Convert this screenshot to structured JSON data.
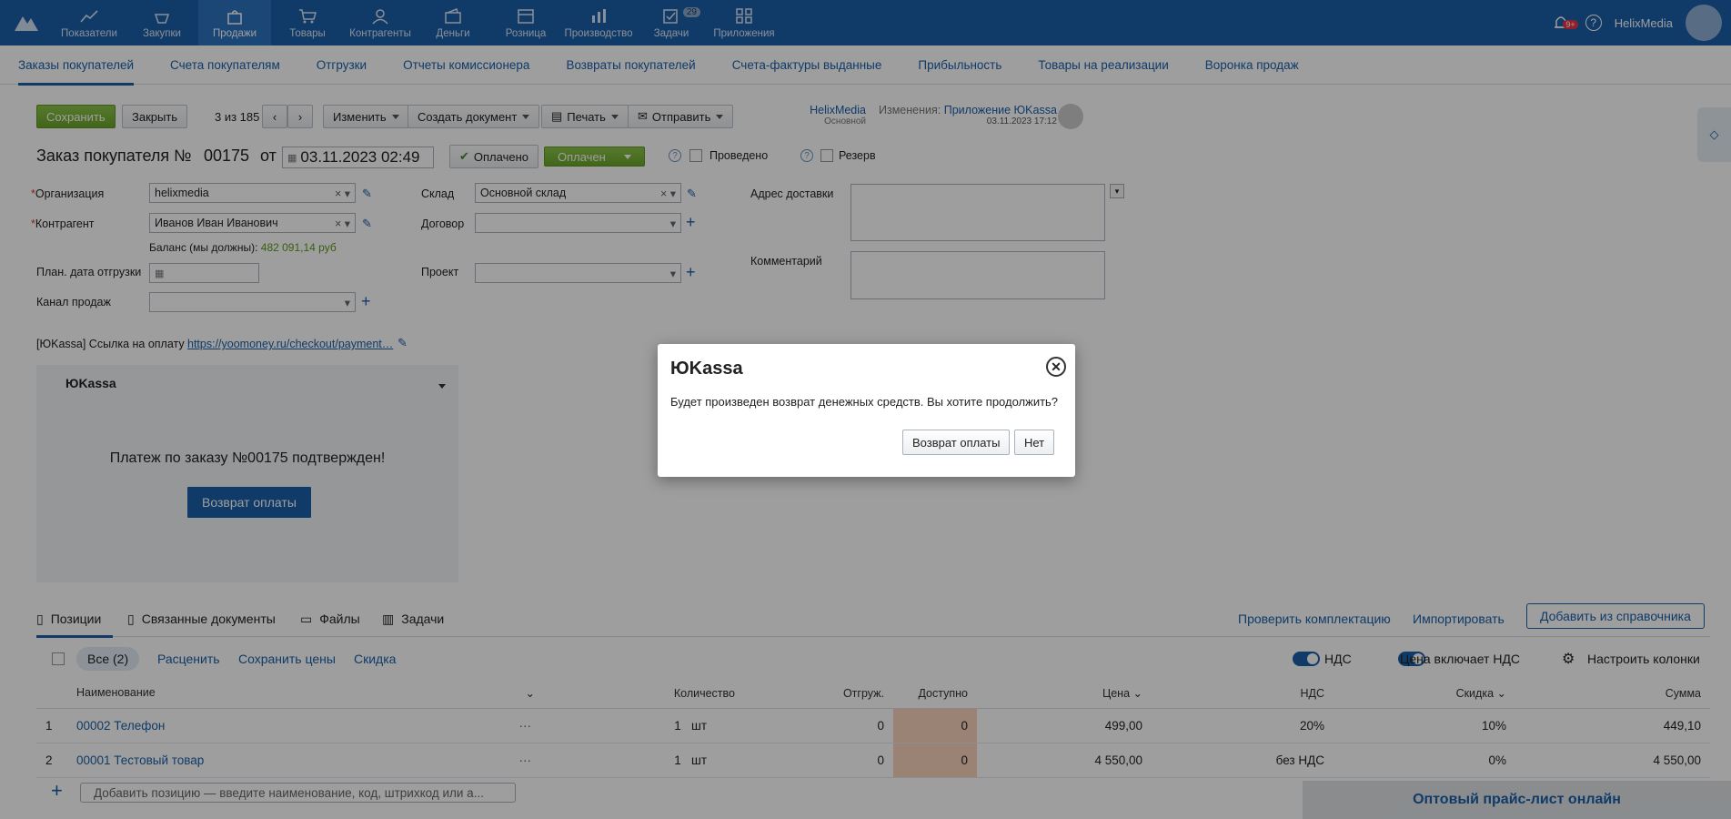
{
  "nav": {
    "items": [
      {
        "label": "Показатели",
        "icon": "chart-line-icon"
      },
      {
        "label": "Закупки",
        "icon": "basket-icon"
      },
      {
        "label": "Продажи",
        "icon": "bag-icon"
      },
      {
        "label": "Товары",
        "icon": "cart-icon"
      },
      {
        "label": "Контрагенты",
        "icon": "people-icon"
      },
      {
        "label": "Деньги",
        "icon": "wallet-icon"
      },
      {
        "label": "Розница",
        "icon": "store-icon"
      },
      {
        "label": "Производство",
        "icon": "factory-icon"
      },
      {
        "label": "Задачи",
        "icon": "tasks-icon",
        "badge": "29"
      },
      {
        "label": "Приложения",
        "icon": "apps-icon"
      }
    ],
    "notifications_badge": "9+",
    "help": "?",
    "user": "HelixMedia"
  },
  "subnav": [
    "Заказы покупателей",
    "Счета покупателям",
    "Отгрузки",
    "Отчеты комиссионера",
    "Возвраты покупателей",
    "Счета-фактуры выданные",
    "Прибыльность",
    "Товары на реализации",
    "Воронка продаж"
  ],
  "toolbar": {
    "save": "Сохранить",
    "close": "Закрыть",
    "pager": "3 из 185",
    "change": "Изменить",
    "create_doc": "Создать документ",
    "print": "Печать",
    "send": "Отправить",
    "owner": "HelixMedia",
    "owner_sub": "Основной",
    "changes_label": "Изменения:",
    "changes_link": "Приложение ЮKassa",
    "changes_date": "03.11.2023 17:12"
  },
  "doc": {
    "title": "Заказ покупателя №",
    "number": "00175",
    "from": "от",
    "date": "03.11.2023 02:49",
    "paid_btn": "Оплачено",
    "status": "Оплачен",
    "posted": "Проведено",
    "reserve": "Резерв"
  },
  "form": {
    "org_label": "Организация",
    "org_value": "helixmedia",
    "contr_label": "Контрагент",
    "contr_value": "Иванов Иван Иванович",
    "balance_label": "Баланс (мы должны):",
    "balance_value": "482 091,14 руб",
    "ship_date_label": "План. дата отгрузки",
    "channel_label": "Канал продаж",
    "warehouse_label": "Склад",
    "warehouse_value": "Основной склад",
    "contract_label": "Договор",
    "project_label": "Проект",
    "address_label": "Адрес доставки",
    "comment_label": "Комментарий",
    "yk_link_label": "[ЮKassa] Ссылка на оплату",
    "yk_link_value": "https://yoomoney.ru/checkout/payment…"
  },
  "panel": {
    "title": "ЮKassa",
    "message": "Платеж по заказу №00175 подтвержден!",
    "refund_btn": "Возврат оплаты"
  },
  "tabs": {
    "positions": "Позиции",
    "related": "Связанные документы",
    "files": "Файлы",
    "tasks": "Задачи",
    "check": "Проверить комплектацию",
    "import": "Импортировать",
    "add_from": "Добавить из справочника"
  },
  "filters": {
    "all": "Все (2)",
    "reprice": "Расценить",
    "save_prices": "Сохранить цены",
    "discount": "Скидка",
    "vat": "НДС",
    "price_incl_vat": "Цена включает НДС",
    "columns": "Настроить колонки"
  },
  "table": {
    "headers": [
      "Наименование",
      "Количество",
      "Отгруж.",
      "Доступно",
      "Цена",
      "НДС",
      "Скидка",
      "Сумма"
    ],
    "rows": [
      {
        "n": "1",
        "name": "00002 Телефон",
        "qty": "1",
        "unit": "шт",
        "shipped": "0",
        "avail": "0",
        "price": "499,00",
        "vat": "20%",
        "disc": "10%",
        "sum": "449,10"
      },
      {
        "n": "2",
        "name": "00001 Тестовый товар",
        "qty": "1",
        "unit": "шт",
        "shipped": "0",
        "avail": "0",
        "price": "4 550,00",
        "vat": "без НДС",
        "disc": "0%",
        "sum": "4 550,00"
      }
    ],
    "add_placeholder": "Добавить позицию — введите наименование, код, штрихкод или а..."
  },
  "price_banner": "Оптовый прайс-лист онлайн",
  "dialog": {
    "title": "ЮKassa",
    "text": "Будет произведен возврат денежных средств. Вы хотите продолжить?",
    "confirm": "Возврат оплаты",
    "cancel": "Нет",
    "close": "✕"
  }
}
